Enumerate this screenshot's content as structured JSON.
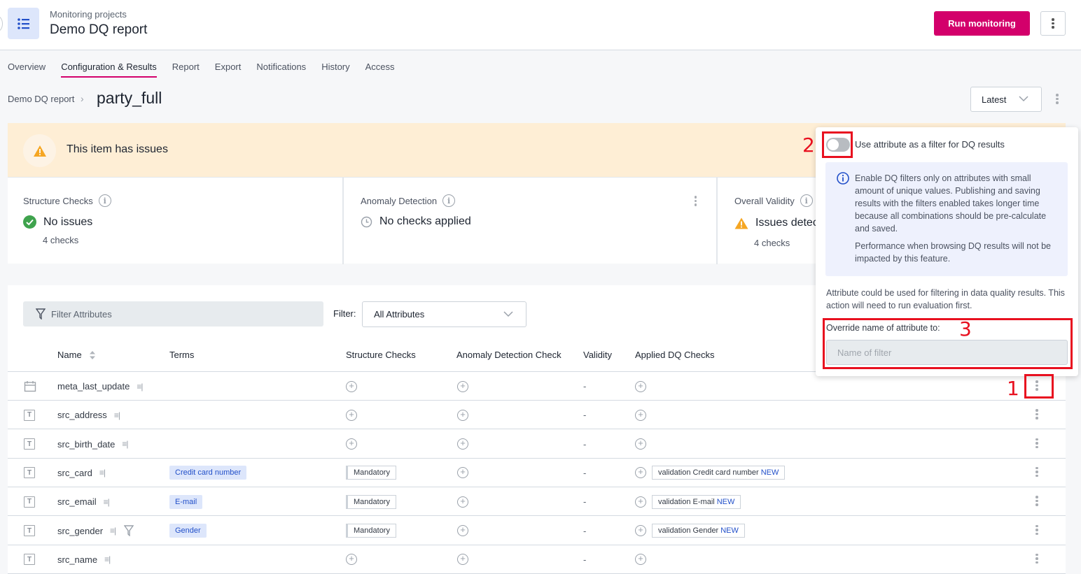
{
  "header": {
    "subtitle": "Monitoring projects",
    "title": "Demo DQ report",
    "app_icon": "list-icon",
    "run_button": "Run monitoring",
    "menu_icon": "more-vertical-icon"
  },
  "tabs": [
    {
      "label": "Overview",
      "active": false
    },
    {
      "label": "Configuration & Results",
      "active": true
    },
    {
      "label": "Report",
      "active": false
    },
    {
      "label": "Export",
      "active": false
    },
    {
      "label": "Notifications",
      "active": false
    },
    {
      "label": "History",
      "active": false
    },
    {
      "label": "Access",
      "active": false
    }
  ],
  "breadcrumb": {
    "parent": "Demo DQ report",
    "separator": "›",
    "current": "party_full"
  },
  "version_select": {
    "value": "Latest"
  },
  "banner": {
    "text": "This item has issues",
    "icon": "warning-icon"
  },
  "summary": {
    "structure": {
      "title": "Structure Checks",
      "status": "No issues",
      "status_icon": "check-circle-icon",
      "sub": "4 checks"
    },
    "anomaly": {
      "title": "Anomaly Detection",
      "status": "No checks applied",
      "status_icon": "clock-icon"
    },
    "validity": {
      "title": "Overall Validity",
      "status": "Issues detec",
      "status_icon": "warning-icon",
      "sub": "4 checks"
    }
  },
  "filters": {
    "search_placeholder": "Filter Attributes",
    "filter_label": "Filter:",
    "filter_value": "All Attributes"
  },
  "table": {
    "columns": [
      "Name",
      "Terms",
      "Structure Checks",
      "Anomaly Detection Check",
      "Validity",
      "Applied DQ Checks"
    ],
    "rows": [
      {
        "type": "date",
        "name": "meta_last_update",
        "term": "",
        "structure": "",
        "validity": "-",
        "dq_check": "",
        "dq_new": "",
        "filter_icon": false
      },
      {
        "type": "text",
        "name": "src_address",
        "term": "",
        "structure": "",
        "validity": "-",
        "dq_check": "",
        "dq_new": "",
        "filter_icon": false
      },
      {
        "type": "text",
        "name": "src_birth_date",
        "term": "",
        "structure": "",
        "validity": "-",
        "dq_check": "",
        "dq_new": "",
        "filter_icon": false
      },
      {
        "type": "text",
        "name": "src_card",
        "term": "Credit card number",
        "structure": "Mandatory",
        "validity": "-",
        "dq_check": "validation Credit card number",
        "dq_new": "NEW",
        "filter_icon": false
      },
      {
        "type": "text",
        "name": "src_email",
        "term": "E-mail",
        "structure": "Mandatory",
        "validity": "-",
        "dq_check": "validation E-mail",
        "dq_new": "NEW",
        "filter_icon": false
      },
      {
        "type": "text",
        "name": "src_gender",
        "term": "Gender",
        "structure": "Mandatory",
        "validity": "-",
        "dq_check": "validation Gender",
        "dq_new": "NEW",
        "filter_icon": true
      },
      {
        "type": "text",
        "name": "src_name",
        "term": "",
        "structure": "",
        "validity": "-",
        "dq_check": "",
        "dq_new": "",
        "filter_icon": false
      }
    ]
  },
  "popover": {
    "toggle_label": "Use attribute as a filter for DQ results",
    "toggle_on": false,
    "info_p1": "Enable DQ filters only on attributes with small amount of unique values. Publishing and saving results with the filters enabled takes longer time because all combinations should be pre-calculate and saved.",
    "info_p2": "Performance when browsing DQ results will not be impacted by this feature.",
    "description": "Attribute could be used for filtering in data quality results. This action will need to run evaluation first.",
    "override_label": "Override name of attribute to:",
    "name_placeholder": "Name of filter",
    "name_value": ""
  },
  "annotations": {
    "one": "1",
    "two": "2",
    "three": "3"
  },
  "colors": {
    "brand": "#d3006b",
    "term_chip": "#dde6fb",
    "link_blue": "#2250c9",
    "warning": "#f5a623",
    "success": "#3fa34d",
    "annotation": "#e8101f"
  }
}
